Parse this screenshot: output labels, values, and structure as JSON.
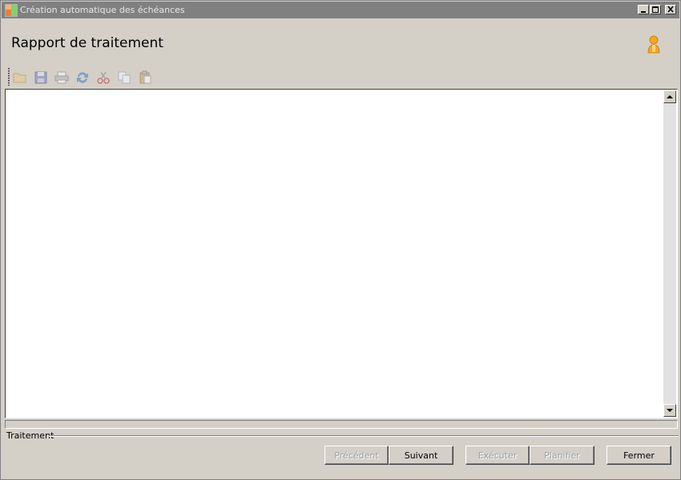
{
  "window": {
    "title": "Création automatique des échéances",
    "controls": [
      "minimize-icon",
      "maximize-icon",
      "close-icon"
    ]
  },
  "header": {
    "title": "Rapport de traitement",
    "user_icon": "user-icon"
  },
  "toolbar": {
    "items": [
      {
        "name": "open-folder-icon",
        "enabled": false
      },
      {
        "name": "save-icon",
        "enabled": false
      },
      {
        "name": "print-icon",
        "enabled": false
      },
      {
        "name": "refresh-icon",
        "enabled": false
      },
      {
        "name": "cut-icon",
        "enabled": false
      },
      {
        "name": "copy-icon",
        "enabled": false
      },
      {
        "name": "paste-icon",
        "enabled": false
      }
    ]
  },
  "log": {
    "content": ""
  },
  "progress": {
    "value": 0
  },
  "footer": {
    "group_label": "Traitement",
    "buttons": {
      "previous": "Précédent",
      "next": "Suivant",
      "execute": "Exécuter",
      "schedule": "Planifier",
      "close": "Fermer"
    }
  },
  "colors": {
    "titlebar": "#808080",
    "dialog_bg": "#d4d0c8",
    "user_icon": "#f5a623"
  }
}
